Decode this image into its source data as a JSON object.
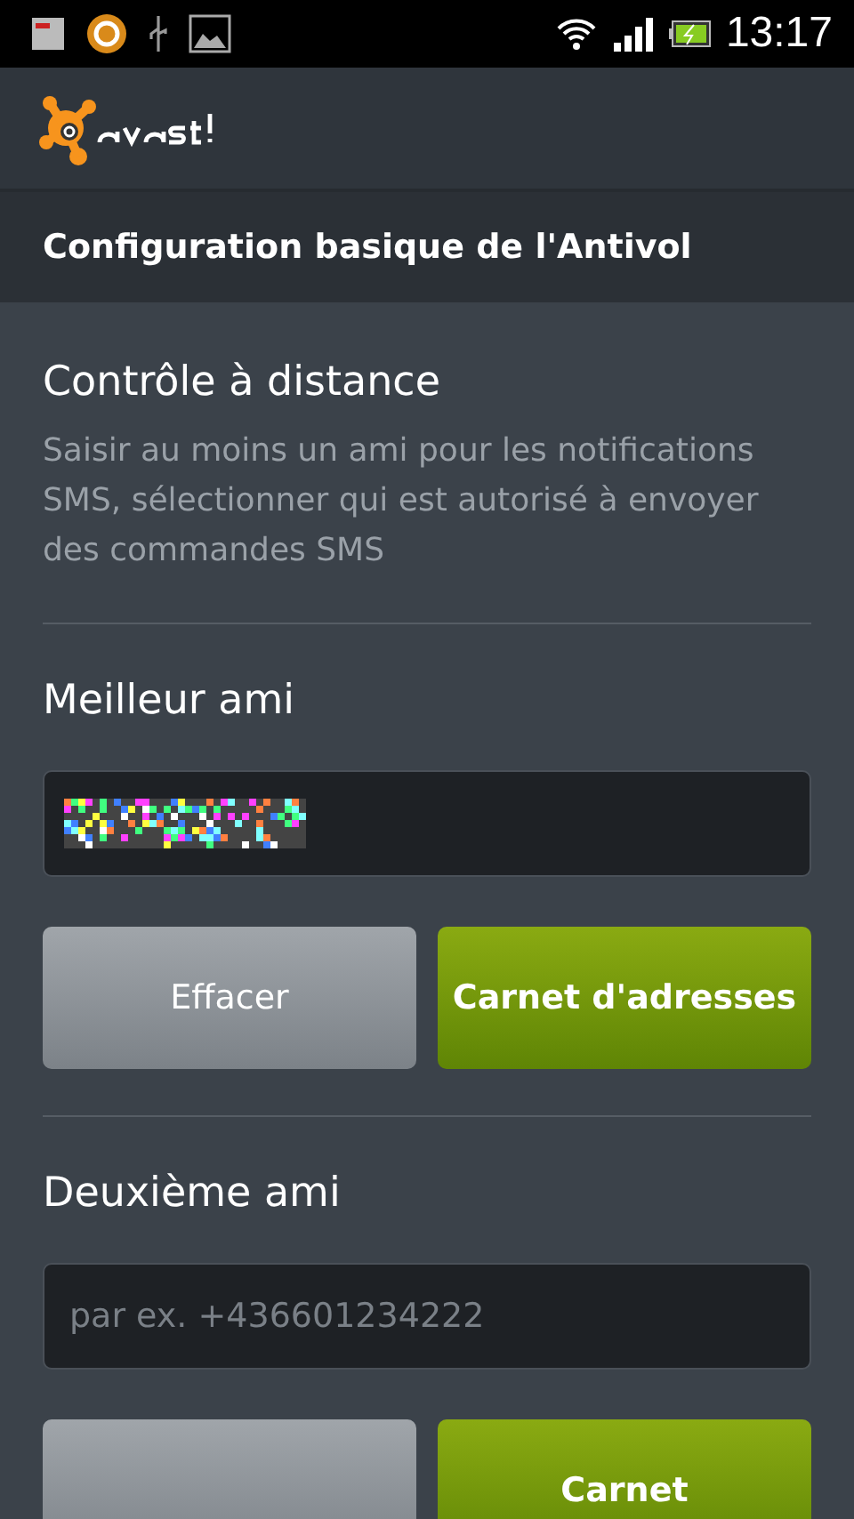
{
  "status_bar": {
    "time": "13:17"
  },
  "title_bar": {
    "title": "Configuration basique de l'Antivol"
  },
  "section": {
    "heading": "Contrôle à distance",
    "description": "Saisir au moins un ami pour les notifications SMS, sélectionner qui est autorisé à envoyer des commandes SMS"
  },
  "friends": [
    {
      "label": "Meilleur ami",
      "field": {
        "kind": "redacted"
      },
      "buttons": [
        {
          "label": "Effacer",
          "kind": "grey"
        },
        {
          "label": "Carnet d'adresses",
          "kind": "green"
        }
      ]
    },
    {
      "label": "Deuxième ami",
      "field": {
        "kind": "empty",
        "placeholder": "par ex. +436601234222"
      },
      "buttons": [
        {
          "kind": "grey"
        },
        {
          "label": "Carnet",
          "kind": "green"
        }
      ]
    }
  ]
}
